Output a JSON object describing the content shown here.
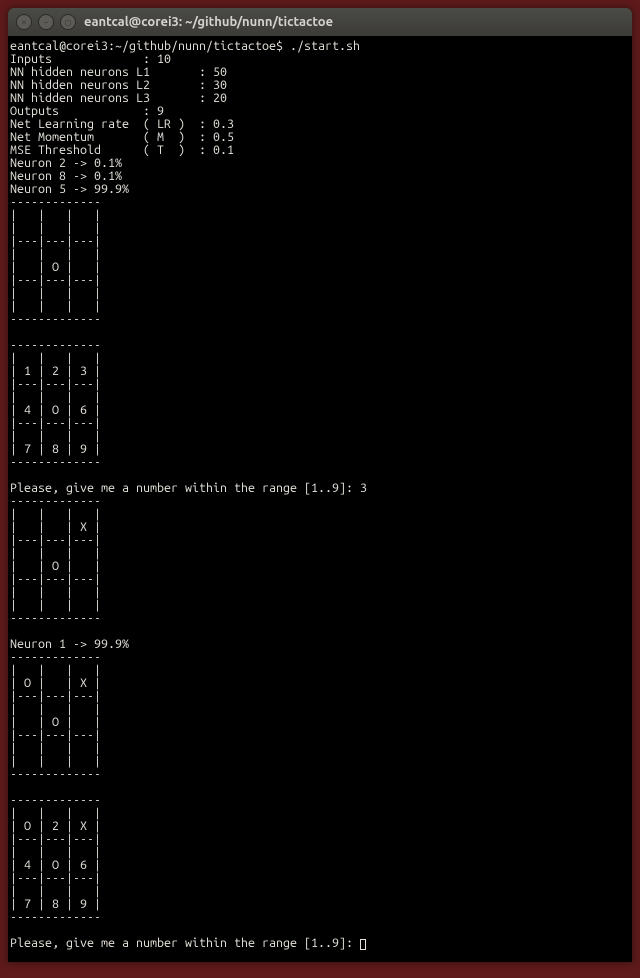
{
  "window": {
    "title": "eantcal@corei3: ~/github/nunn/tictactoe"
  },
  "prompt": {
    "user_host_path": "eantcal@corei3:~/github/nunn/tictactoe$",
    "command": "./start.sh"
  },
  "params": {
    "inputs_label": "Inputs",
    "inputs_value": "10",
    "l1_label": "NN hidden neurons L1",
    "l1_value": "50",
    "l2_label": "NN hidden neurons L2",
    "l2_value": "30",
    "l3_label": "NN hidden neurons L3",
    "l3_value": "20",
    "outputs_label": "Outputs",
    "outputs_value": "9",
    "lr_label": "Net Learning rate  ( LR )",
    "lr_value": "0.3",
    "mom_label": "Net Momentum       ( M  )",
    "mom_value": "0.5",
    "mse_label": "MSE Threshold      ( T  )",
    "mse_value": "0.1"
  },
  "neurons1": {
    "n2": "Neuron 2 -> 0.1%",
    "n8": "Neuron 8 -> 0.1%",
    "n5": "Neuron 5 -> 99.9%"
  },
  "board1": {
    "border": "-------------",
    "row1a": "|   |   |   |",
    "row1b": "|   |   |   |",
    "row2a": "|   |   |   |",
    "row2b": "|   | O |   |",
    "row3a": "|   |   |   |",
    "row3b": "|   |   |   |",
    "sep": "|---|---|---|"
  },
  "board2": {
    "r1": "| 1 | 2 | 3 |",
    "r2": "| 4 | O | 6 |",
    "r3": "| 7 | 8 | 9 |"
  },
  "prompt1": {
    "text": "Please, give me a number within the range [1..9]: ",
    "input": "3"
  },
  "board3": {
    "r1a": "|   |   |   |",
    "r1b": "|   |   | X |",
    "r2a": "|   |   |   |",
    "r2b": "|   | O |   |",
    "r3a": "|   |   |   |",
    "r3b": "|   |   |   |"
  },
  "neurons2": {
    "n1": "Neuron 1 -> 99.9%"
  },
  "board4": {
    "r1a": "|   |   |   |",
    "r1b": "| O |   | X |",
    "r2a": "|   |   |   |",
    "r2b": "|   | O |   |",
    "r3a": "|   |   |   |",
    "r3b": "|   |   |   |"
  },
  "board5": {
    "r1": "| O | 2 | X |",
    "r2": "| 4 | O | 6 |",
    "r3": "| 7 | 8 | 9 |"
  },
  "prompt2": {
    "text": "Please, give me a number within the range [1..9]: "
  }
}
